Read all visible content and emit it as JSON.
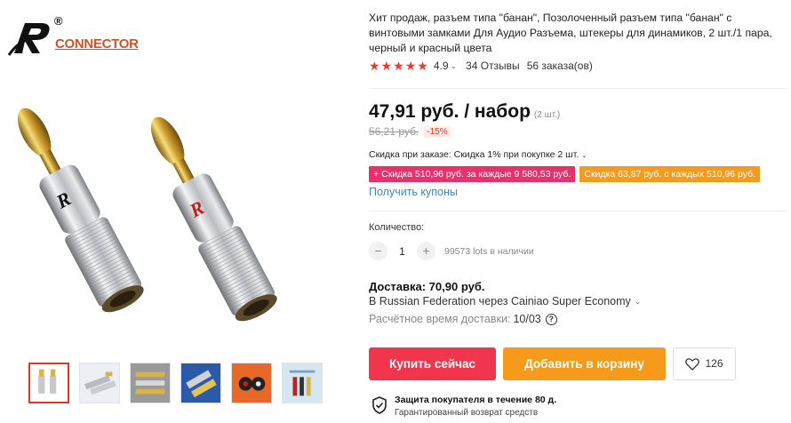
{
  "brand": {
    "registered_mark": "®",
    "name": "CONNECTOR"
  },
  "product": {
    "title": "Хит продаж, разъем типа \"банан\", Позолоченный разъем типа \"банан\" с винтовыми замками Для Аудио Разъема, штекеры для динамиков, 2 шт./1 пара, черный и красный цвета",
    "rating": {
      "score": "4.9",
      "reviews": "34 Отзывы",
      "orders": "56 заказа(ов)"
    },
    "price": {
      "main": "47,91 руб. / набор",
      "unit_note": "(2 шт.)",
      "old": "56,21 руб.",
      "discount": "-15%"
    },
    "order_discount": "Скидка при заказе: Скидка 1% при покупке 2 шт.",
    "coupons": [
      "Скидка 510,96 руб. за каждые 9 580,53 руб.",
      "Скидка 63,87 руб. с каждых 510,96 руб."
    ],
    "get_coupons": "Получить купоны",
    "quantity": {
      "label": "Количество:",
      "minus": "−",
      "value": "1",
      "plus": "+",
      "stock": "99573 lots в наличии"
    },
    "shipping": {
      "title": "Доставка: 70,90 руб.",
      "route": "В Russian Federation через Cainiao Super Economy",
      "time_label": "Расчётное время доставки:",
      "time_value": "10/03",
      "help": "?"
    },
    "buttons": {
      "buy": "Купить сейчас",
      "cart": "Добавить в корзину",
      "wishlist_count": "126"
    },
    "protection": {
      "title": "Защита покупателя в течение 80 д.",
      "subtitle": "Гарантированный возврат средств"
    }
  },
  "colors": {
    "buy": "#f0354c",
    "cart": "#f59a1b",
    "coupon_pink": "#ea2f6b",
    "coupon_orange": "#f59a1b",
    "link": "#3a87c7",
    "star": "#f0392b",
    "brand": "#c8552a"
  }
}
